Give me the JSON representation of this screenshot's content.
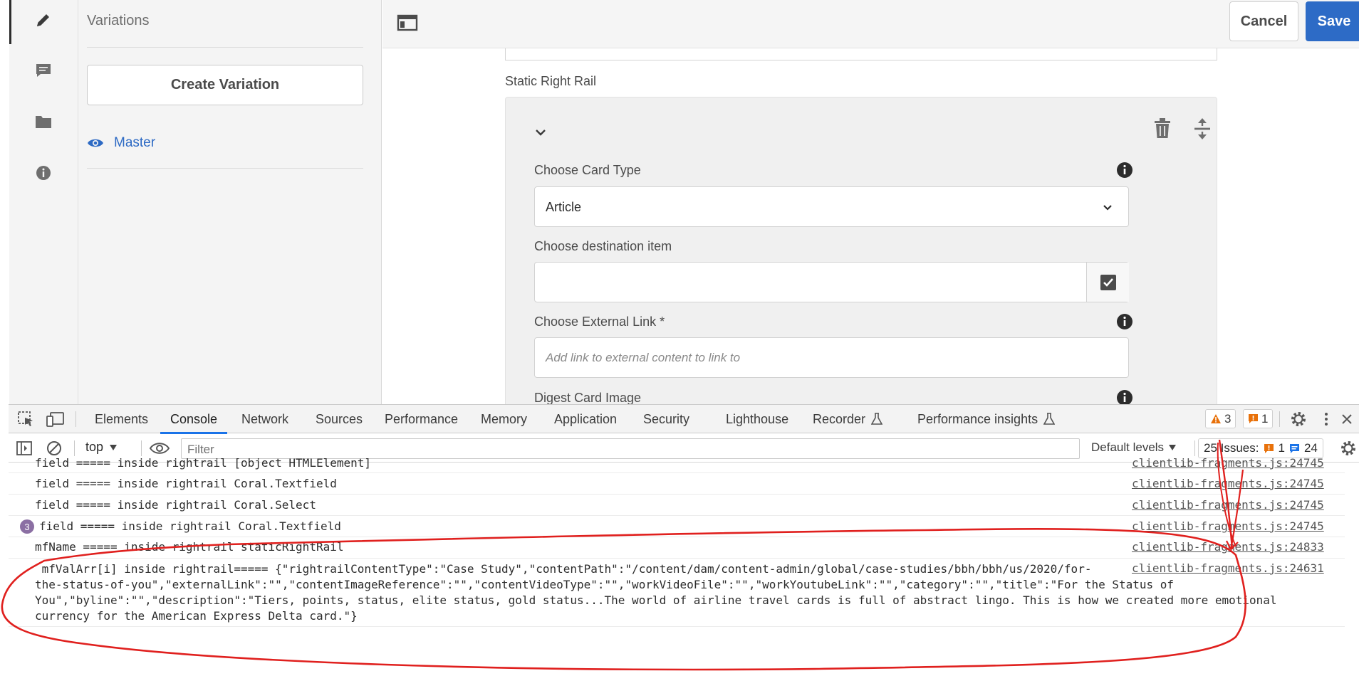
{
  "sidepanel": {
    "title": "Variations",
    "create_label": "Create Variation",
    "master_label": "Master"
  },
  "rail": {
    "icons": [
      "pencil-icon",
      "comment-icon",
      "folder-icon",
      "info-icon"
    ]
  },
  "toolbar": {
    "cancel_label": "Cancel",
    "save_label": "Save"
  },
  "form": {
    "section_label": "Static Right Rail",
    "card_type_label": "Choose Card Type",
    "card_type_value": "Article",
    "destination_label": "Choose destination item",
    "destination_value": "",
    "external_link_label": "Choose External Link *",
    "external_link_placeholder": "Add link to external content to link to",
    "digest_image_label": "Digest Card Image"
  },
  "devtools": {
    "tabs": [
      "Elements",
      "Console",
      "Network",
      "Sources",
      "Performance",
      "Memory",
      "Application",
      "Security",
      "Lighthouse",
      "Recorder",
      "Performance insights"
    ],
    "active_tab": "Console",
    "warnings_count": "3",
    "errors_count": "1",
    "context": "top",
    "filter_placeholder": "Filter",
    "levels_label": "Default levels",
    "issues_label": "25 Issues:",
    "issues_errors": "1",
    "issues_info": "24",
    "colors": {
      "accent": "#1a73e8",
      "warning": "#e8710a",
      "error": "#d93025"
    }
  },
  "console": {
    "rows": [
      {
        "msg": "field ===== inside rightrail [object HTMLElement]",
        "src": "clientlib-fragments.js:24745"
      },
      {
        "msg": "field ===== inside rightrail Coral.Textfield",
        "src": "clientlib-fragments.js:24745"
      },
      {
        "msg": "field ===== inside rightrail Coral.Select",
        "src": "clientlib-fragments.js:24745"
      },
      {
        "msg": "field ===== inside rightrail Coral.Textfield",
        "src": "clientlib-fragments.js:24745",
        "repeat": "3"
      },
      {
        "msg": "mfName ===== inside rightrail staticRightRail",
        "src": "clientlib-fragments.js:24833"
      }
    ],
    "long": {
      "line1": " mfValArr[i] inside rightrail===== {\"rightrailContentType\":\"Case Study\",\"contentPath\":\"/content/dam/content-admin/global/case-studies/bbh/bbh/us/2020/for-",
      "line2": "the-status-of-you\",\"externalLink\":\"\",\"contentImageReference\":\"\",\"contentVideoType\":\"\",\"workVideoFile\":\"\",\"workYoutubeLink\":\"\",\"category\":\"\",\"title\":\"For the Status of",
      "line3": "You\",\"byline\":\"\",\"description\":\"Tiers, points, status, elite status, gold status...The world of airline travel cards is full of abstract lingo. This is how we created more emotional",
      "line4": "currency for the American Express Delta card.\"}",
      "src": "clientlib-fragments.js:24631"
    }
  }
}
